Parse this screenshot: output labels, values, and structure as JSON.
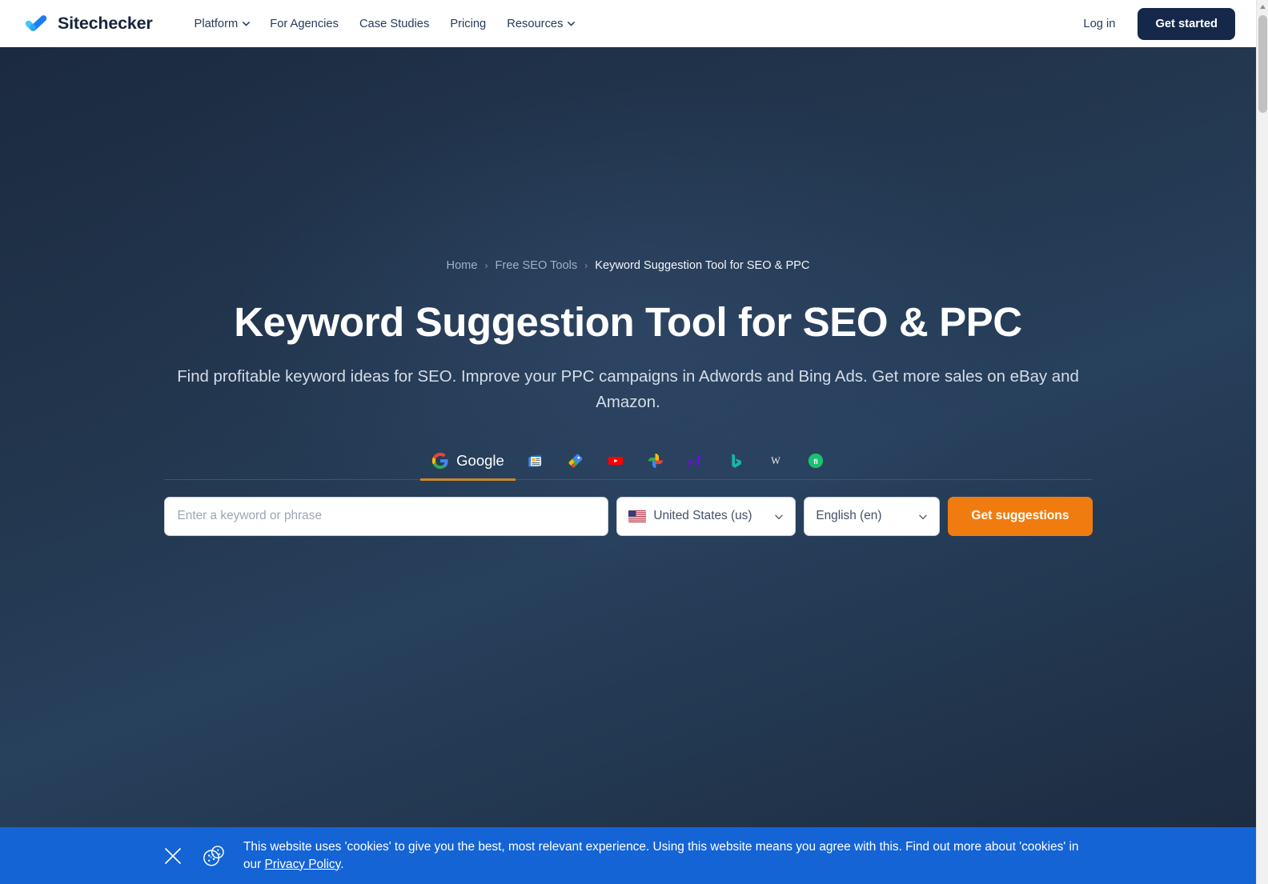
{
  "brand": {
    "name": "Sitechecker",
    "logo_icon": "checkmark-logo-icon"
  },
  "header": {
    "nav": [
      {
        "label": "Platform",
        "has_caret": true
      },
      {
        "label": "For Agencies",
        "has_caret": false
      },
      {
        "label": "Case Studies",
        "has_caret": false
      },
      {
        "label": "Pricing",
        "has_caret": false
      },
      {
        "label": "Resources",
        "has_caret": true
      }
    ],
    "login_label": "Log in",
    "get_started_label": "Get started"
  },
  "breadcrumb": {
    "home": "Home",
    "parent": "Free SEO Tools",
    "current": "Keyword Suggestion Tool for SEO & PPC",
    "separator": "›"
  },
  "hero": {
    "title": "Keyword Suggestion Tool for SEO & PPC",
    "subtitle": "Find profitable keyword ideas for SEO. Improve your PPC campaigns in Adwords and Bing Ads. Get more sales on eBay and Amazon."
  },
  "engines": [
    {
      "label": "Google",
      "icon": "google-icon",
      "active": true
    },
    {
      "label": "",
      "icon": "google-news-icon",
      "active": false
    },
    {
      "label": "",
      "icon": "google-shopping-icon",
      "active": false
    },
    {
      "label": "",
      "icon": "youtube-icon",
      "active": false
    },
    {
      "label": "",
      "icon": "google-photos-icon",
      "active": false
    },
    {
      "label": "",
      "icon": "yahoo-icon",
      "active": false
    },
    {
      "label": "",
      "icon": "bing-icon",
      "active": false
    },
    {
      "label": "",
      "icon": "wikipedia-icon",
      "active": false
    },
    {
      "label": "",
      "icon": "fiverr-icon",
      "active": false
    }
  ],
  "search": {
    "keyword_value": "",
    "keyword_placeholder": "Enter a keyword or phrase",
    "country_value": "United States (us)",
    "country_flag_icon": "us-flag-icon",
    "language_value": "English (en)",
    "submit_label": "Get suggestions"
  },
  "cookie": {
    "close_icon": "close-icon",
    "cookie_icon": "cookie-icon",
    "text_before_link": "This website uses 'cookies' to give you the best, most relevant experience. Using this website means you agree with this. Find out more about 'cookies' in our ",
    "link_label": "Privacy Policy",
    "text_after_link": "."
  },
  "colors": {
    "brand_navy": "#16284a",
    "accent_orange": "#f07c10",
    "cookie_blue": "#1464d6",
    "tab_underline": "#c8872c",
    "hero_bg_dark": "#1b2a40",
    "hero_bg_light": "#27405c"
  },
  "scrollbar": {
    "present": true
  }
}
